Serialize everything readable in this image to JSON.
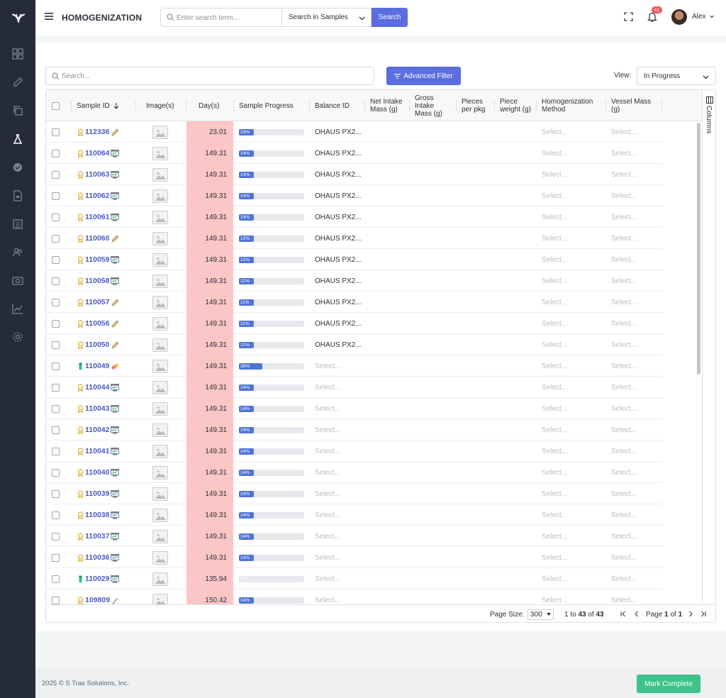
{
  "app": {
    "title": "HOMOGENIZATION"
  },
  "colors": {
    "primary": "#5a6ee0",
    "success": "#3ec38b",
    "sidebar": "#262b3a",
    "day_highlight": "#fcc6c6",
    "progress": "#4f74d9",
    "badge": "#f0545b"
  },
  "sidebar": {
    "items": [
      {
        "name": "dashboard-icon"
      },
      {
        "name": "pencil-icon"
      },
      {
        "name": "copy-icon"
      },
      {
        "name": "flask-icon",
        "active": true
      },
      {
        "name": "badge-check-icon"
      },
      {
        "name": "file-icon"
      },
      {
        "name": "list-icon"
      },
      {
        "name": "users-icon"
      },
      {
        "name": "camera-icon"
      },
      {
        "name": "chart-icon"
      },
      {
        "name": "gear-icon"
      }
    ]
  },
  "topbar": {
    "search_placeholder": "Enter search term...",
    "scope_label": "Search in Samples",
    "search_button": "Search",
    "notification_count": "61",
    "user_name": "Alex"
  },
  "toolbar": {
    "search_placeholder": "Search...",
    "advanced_filter": "Advanced Filter",
    "view_label": "View:",
    "view_value": "In Progress"
  },
  "columns": {
    "sample_id": "Sample ID",
    "images": "Image(s)",
    "days": "Day(s)",
    "sample_progress": "Sample Progress",
    "balance_id": "Balance ID",
    "net_intake_mass": "Net Intake Mass (g)",
    "gross_intake_mass": "Gross Intake Mass (g)",
    "pieces_per_pkg": "Pieces per pkg",
    "piece_weight": "Piece weight (g)",
    "homogenization_method": "Homogenization Method",
    "vessel_mass": "Vessel Mass (g)"
  },
  "select_placeholder": "Select...",
  "rows": [
    {
      "id": "112336",
      "status": "award",
      "type": "pencil",
      "days": "23.01",
      "progress": 23,
      "progress_label": "23%",
      "balance": "OHAUS PX2..."
    },
    {
      "id": "110064",
      "status": "award",
      "type": "screen",
      "days": "149.31",
      "progress": 14,
      "progress_label": "14%",
      "balance": "OHAUS PX2..."
    },
    {
      "id": "110063",
      "status": "award",
      "type": "screen",
      "days": "149.31",
      "progress": 14,
      "progress_label": "14%",
      "balance": "OHAUS PX2..."
    },
    {
      "id": "110062",
      "status": "award",
      "type": "screen",
      "days": "149.31",
      "progress": 14,
      "progress_label": "14%",
      "balance": "OHAUS PX2..."
    },
    {
      "id": "110061",
      "status": "award",
      "type": "screen",
      "days": "149.31",
      "progress": 14,
      "progress_label": "14%",
      "balance": "OHAUS PX2..."
    },
    {
      "id": "110060",
      "status": "award",
      "type": "pencil",
      "days": "149.31",
      "progress": 12,
      "progress_label": "12%",
      "balance": "OHAUS PX2..."
    },
    {
      "id": "110059",
      "status": "award",
      "type": "screen",
      "days": "149.31",
      "progress": 12,
      "progress_label": "12%",
      "balance": "OHAUS PX2..."
    },
    {
      "id": "110058",
      "status": "award",
      "type": "screen",
      "days": "149.31",
      "progress": 12,
      "progress_label": "12%",
      "balance": "OHAUS PX2..."
    },
    {
      "id": "110057",
      "status": "award",
      "type": "pencil",
      "days": "149.31",
      "progress": 11,
      "progress_label": "11%",
      "balance": "OHAUS PX2..."
    },
    {
      "id": "110056",
      "status": "award",
      "type": "pencil",
      "days": "149.31",
      "progress": 11,
      "progress_label": "11%",
      "balance": "OHAUS PX2..."
    },
    {
      "id": "110050",
      "status": "award",
      "type": "pencil",
      "days": "149.31",
      "progress": 12,
      "progress_label": "12%",
      "balance": "OHAUS PX2..."
    },
    {
      "id": "110049",
      "status": "tube",
      "type": "pill",
      "days": "149.31",
      "progress": 36,
      "progress_label": "36%",
      "balance": ""
    },
    {
      "id": "110044",
      "status": "award",
      "type": "screen",
      "days": "149.31",
      "progress": 14,
      "progress_label": "14%",
      "balance": ""
    },
    {
      "id": "110043",
      "status": "award",
      "type": "screen",
      "days": "149.31",
      "progress": 14,
      "progress_label": "14%",
      "balance": ""
    },
    {
      "id": "110042",
      "status": "award",
      "type": "screen",
      "days": "149.31",
      "progress": 14,
      "progress_label": "14%",
      "balance": ""
    },
    {
      "id": "110041",
      "status": "award",
      "type": "screen",
      "days": "149.31",
      "progress": 14,
      "progress_label": "14%",
      "balance": ""
    },
    {
      "id": "110040",
      "status": "award",
      "type": "screen",
      "days": "149.31",
      "progress": 14,
      "progress_label": "14%",
      "balance": ""
    },
    {
      "id": "110039",
      "status": "award",
      "type": "screen",
      "days": "149.31",
      "progress": 14,
      "progress_label": "14%",
      "balance": ""
    },
    {
      "id": "110038",
      "status": "award",
      "type": "screen",
      "days": "149.31",
      "progress": 14,
      "progress_label": "14%",
      "balance": ""
    },
    {
      "id": "110037",
      "status": "award",
      "type": "screen",
      "days": "149.31",
      "progress": 14,
      "progress_label": "14%",
      "balance": ""
    },
    {
      "id": "110036",
      "status": "award",
      "type": "screen",
      "days": "149.31",
      "progress": 14,
      "progress_label": "14%",
      "balance": ""
    },
    {
      "id": "110029",
      "status": "tube",
      "type": "screen",
      "days": "135.94",
      "progress": 0,
      "progress_label": "0%",
      "balance": ""
    },
    {
      "id": "109809",
      "status": "award",
      "type": "brush",
      "days": "150.42",
      "progress": 14,
      "progress_label": "14%",
      "balance": ""
    }
  ],
  "side_panel": {
    "columns_label": "Columns"
  },
  "pagination": {
    "page_size_label": "Page Size:",
    "page_size": "300",
    "range_from": "1",
    "range_to_label": "to",
    "range_to": "43",
    "of_label": "of",
    "total": "43",
    "page_label": "Page",
    "page": "1",
    "page_of_label": "of",
    "pages": "1"
  },
  "footer": {
    "copyright": "2025 © S Trax Solutions, Inc.",
    "complete_button": "Mark Complete"
  }
}
